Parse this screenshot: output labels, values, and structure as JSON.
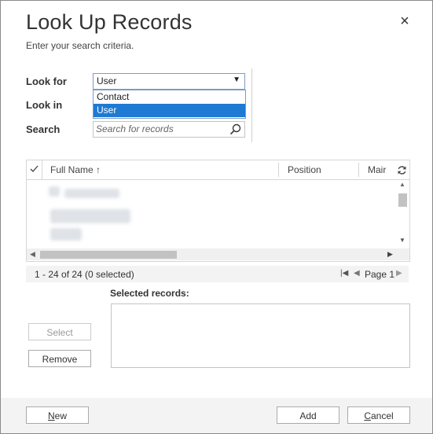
{
  "dialog": {
    "title": "Look Up Records",
    "subtitle": "Enter your search criteria.",
    "close_glyph": "×"
  },
  "form": {
    "look_for_label": "Look for",
    "look_in_label": "Look in",
    "search_label": "Search",
    "look_for_value": "User",
    "dropdown_arrow": "▼",
    "dropdown_options": [
      "Contact",
      "User"
    ],
    "search_placeholder": "Search for records"
  },
  "grid": {
    "columns": [
      "Full Name ↑",
      "Position",
      "Mair"
    ]
  },
  "status": {
    "count_text": "1 - 24 of 24 (0 selected)",
    "page_label": "Page 1"
  },
  "selected": {
    "label": "Selected records:"
  },
  "buttons": {
    "select": "Select",
    "remove": "Remove",
    "new_first": "N",
    "new_rest": "ew",
    "add": "Add",
    "cancel_first": "C",
    "cancel_rest": "ancel"
  },
  "icons": {
    "close": "close-icon",
    "search": "search-icon",
    "refresh": "refresh-icon",
    "check": "check-icon",
    "first_page": "first-page-icon",
    "prev_page": "prev-page-icon",
    "next_page": "next-page-icon"
  }
}
